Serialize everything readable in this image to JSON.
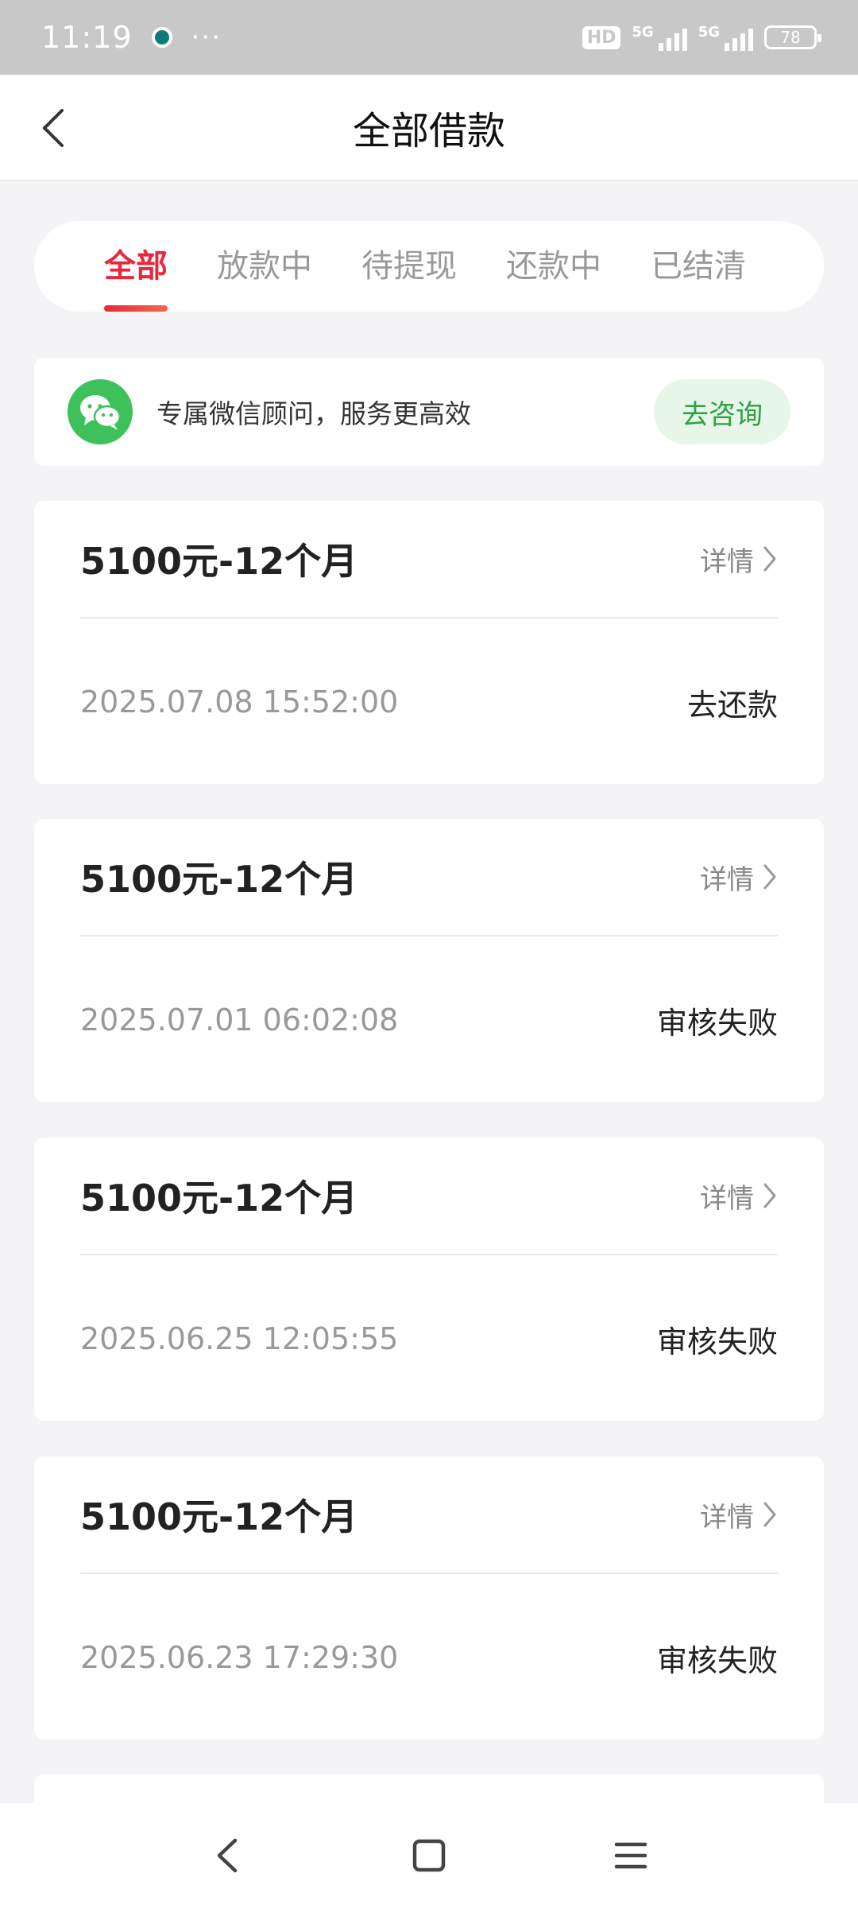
{
  "status_bar": {
    "time": "11:19",
    "more": "···",
    "hd": "HD",
    "net1": "5G",
    "net2": "5G",
    "battery": "78"
  },
  "header": {
    "title": "全部借款"
  },
  "tabs": [
    {
      "label": "全部",
      "active": true
    },
    {
      "label": "放款中",
      "active": false
    },
    {
      "label": "待提现",
      "active": false
    },
    {
      "label": "还款中",
      "active": false
    },
    {
      "label": "已结清",
      "active": false
    }
  ],
  "wechat_banner": {
    "text": "专属微信顾问，服务更高效",
    "button": "去咨询"
  },
  "loans": [
    {
      "amount": "5100元-12个月",
      "detail": "详情",
      "date": "2025.07.08 15:52:00",
      "status": "去还款"
    },
    {
      "amount": "5100元-12个月",
      "detail": "详情",
      "date": "2025.07.01 06:02:08",
      "status": "审核失败"
    },
    {
      "amount": "5100元-12个月",
      "detail": "详情",
      "date": "2025.06.25 12:05:55",
      "status": "审核失败"
    },
    {
      "amount": "5100元-12个月",
      "detail": "详情",
      "date": "2025.06.23 17:29:30",
      "status": "审核失败"
    }
  ],
  "colors": {
    "accent": "#e8283c",
    "wechat_green": "#3ec15a"
  }
}
